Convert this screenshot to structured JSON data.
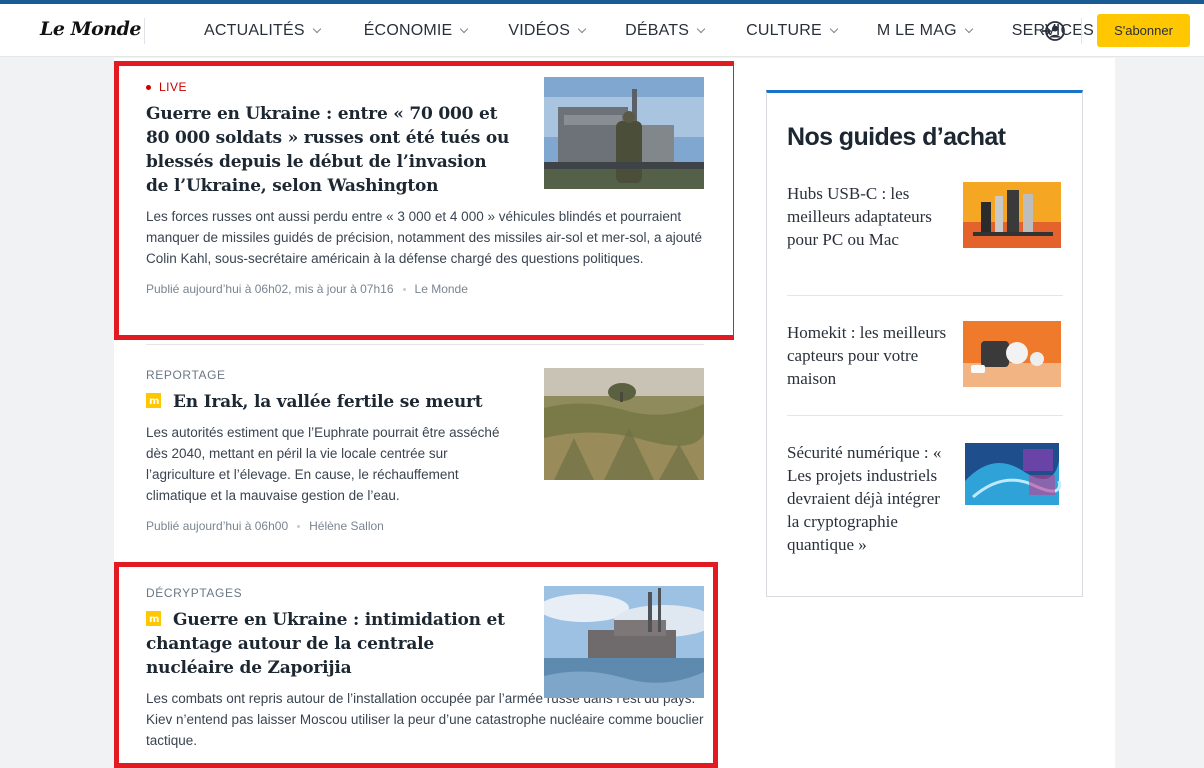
{
  "header": {
    "logo": "Le Monde",
    "nav": [
      {
        "label": "ACTUALITÉS",
        "dropdown": true
      },
      {
        "label": "ÉCONOMIE",
        "dropdown": true
      },
      {
        "label": "VIDÉOS",
        "dropdown": true
      },
      {
        "label": "DÉBATS",
        "dropdown": true
      },
      {
        "label": "CULTURE",
        "dropdown": true
      },
      {
        "label": "M LE MAG",
        "dropdown": true
      },
      {
        "label": "SERVICES",
        "dropdown": true
      }
    ],
    "account_icon": "user-login-icon",
    "subscribe_label": "S'abonner"
  },
  "articles": [
    {
      "live_label": "LIVE",
      "title": "Guerre en Ukraine : entre « 70 000 et 80 000 soldats » russes ont été tués ou blessés depuis le début de l’invasion de l’Ukraine, selon Washington",
      "summary": "Les forces russes ont aussi perdu entre « 3 000 et 4 000 » véhicules blindés et pourraient manquer de missiles guidés de précision, notamment des missiles air-sol et mer-sol, a ajouté Colin Kahl, sous-secrétaire américain à la défense chargé des questions politiques.",
      "date": "Publié aujourd’hui à 06h02, mis à jour à 07h16",
      "author": "Le Monde",
      "highlighted": true
    },
    {
      "kicker": "REPORTAGE",
      "subscriber": true,
      "title": "En Irak, la vallée fertile se meurt",
      "summary": "Les autorités estiment que l’Euphrate pourrait être asséché dès 2040, mettant en péril la vie locale centrée sur l’agriculture et l’élevage. En cause, le réchauffement climatique et la mauvaise gestion de l’eau.",
      "date": "Publié aujourd’hui à 06h00",
      "author": "Hélène Sallon",
      "highlighted": false
    },
    {
      "kicker": "DÉCRYPTAGES",
      "subscriber": true,
      "title": "Guerre en Ukraine : intimidation et chantage autour de la centrale nucléaire de Zaporijia",
      "summary": "Les combats ont repris autour de l’installation occupée par l’armée russe dans l’est du pays. Kiev n’entend pas laisser Moscou utiliser la peur d’une catastrophe nucléaire comme bouclier tactique.",
      "highlighted": true
    }
  ],
  "sidebar": {
    "title": "Nos guides d’achat",
    "accent_color": "#1a73c8",
    "guides": [
      {
        "text": "Hubs USB-C : les meilleurs adaptateurs pour PC ou Mac"
      },
      {
        "text": "Homekit : les meilleurs capteurs pour votre maison"
      },
      {
        "text": "Sécurité numérique : « Les projets industriels devraient déjà intégrer la cryptographie quantique »"
      }
    ]
  },
  "colors": {
    "highlight_border": "#e21b23",
    "live": "#c80000",
    "subscribe_button": "#ffc700",
    "top_bar": "#1a5a95"
  }
}
